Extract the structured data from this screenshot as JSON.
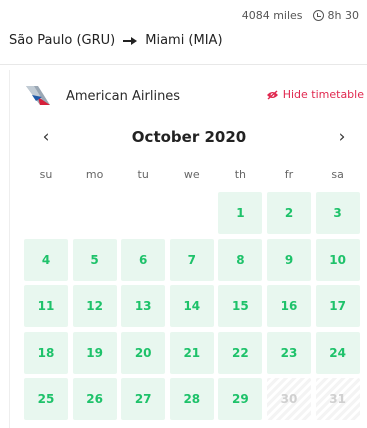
{
  "trip": {
    "distance": "4084 miles",
    "duration": "8h 30",
    "origin": "São Paulo (GRU)",
    "destination": "Miami (MIA)"
  },
  "airline": {
    "name": "American Airlines",
    "hide_label": "Hide timetable"
  },
  "calendar": {
    "month": "October 2020",
    "prev_label": "‹",
    "next_label": "›",
    "weekdays": [
      "su",
      "mo",
      "tu",
      "we",
      "th",
      "fr",
      "sa"
    ],
    "first_weekday_index": 4,
    "days": [
      "1",
      "2",
      "3",
      "4",
      "5",
      "6",
      "7",
      "8",
      "9",
      "10",
      "11",
      "12",
      "13",
      "14",
      "15",
      "16",
      "17",
      "18",
      "19",
      "20",
      "21",
      "22",
      "23",
      "24",
      "25",
      "26",
      "27",
      "28",
      "29",
      "30",
      "31"
    ],
    "disabled_days": [
      "30",
      "31"
    ],
    "available_color": "#1ec26a",
    "available_bg": "#e8f7ef"
  }
}
